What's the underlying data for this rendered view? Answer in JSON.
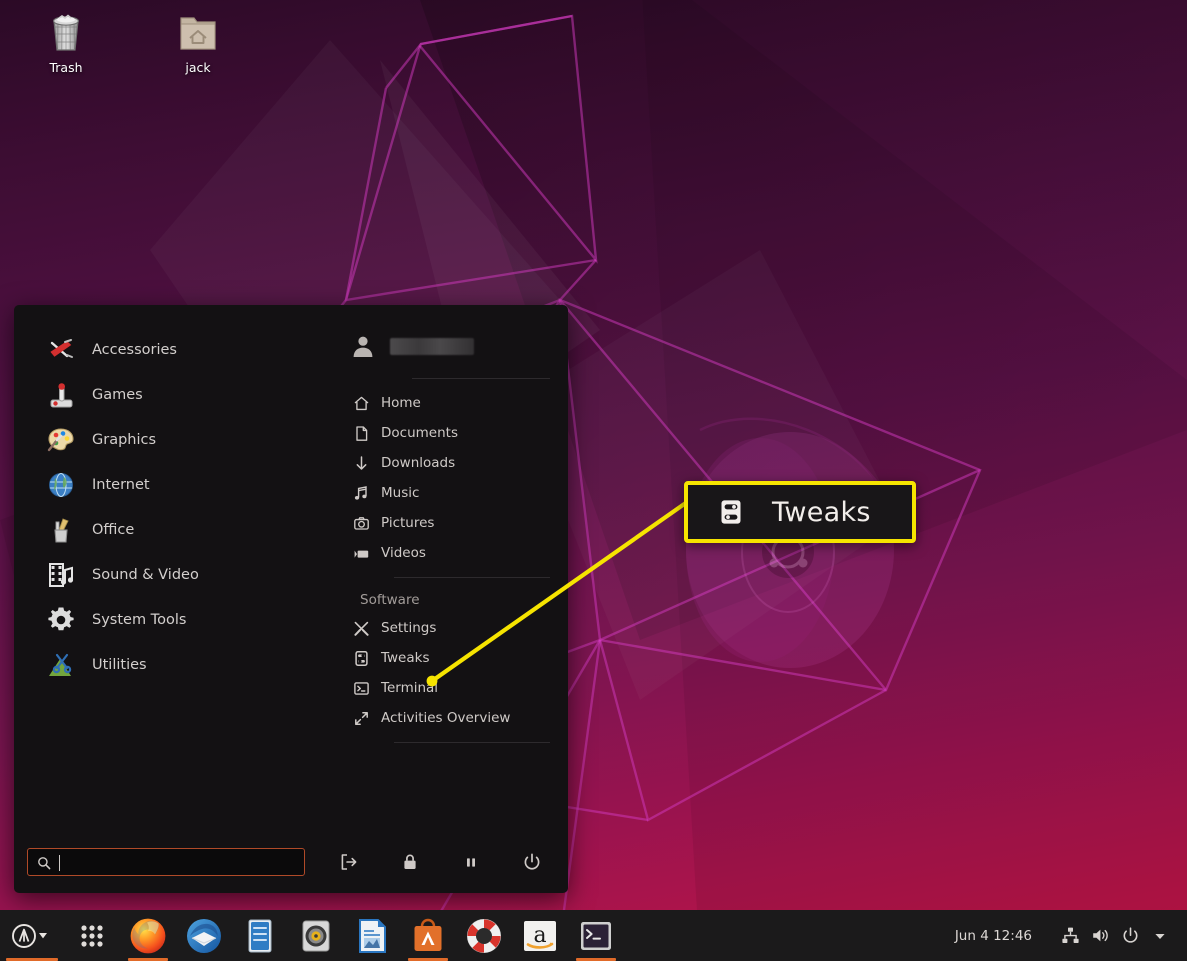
{
  "desktop": {
    "icons": [
      {
        "name": "trash",
        "label": "Trash",
        "icon": "trash-icon"
      },
      {
        "name": "home-folder",
        "label": "jack",
        "icon": "home-folder-icon"
      }
    ]
  },
  "menu": {
    "categories": [
      {
        "label": "Accessories",
        "icon": "swiss-army-knife-icon"
      },
      {
        "label": "Games",
        "icon": "joystick-icon"
      },
      {
        "label": "Graphics",
        "icon": "palette-icon"
      },
      {
        "label": "Internet",
        "icon": "globe-icon"
      },
      {
        "label": "Office",
        "icon": "pencil-cup-icon"
      },
      {
        "label": "Sound & Video",
        "icon": "film-music-icon"
      },
      {
        "label": "System Tools",
        "icon": "gear-icon"
      },
      {
        "label": "Utilities",
        "icon": "scissors-icon"
      }
    ],
    "user": {
      "name_redacted": true,
      "avatar_icon": "user-avatar-icon"
    },
    "places": [
      {
        "label": "Home",
        "icon": "home-icon"
      },
      {
        "label": "Documents",
        "icon": "document-icon"
      },
      {
        "label": "Downloads",
        "icon": "download-arrow-icon"
      },
      {
        "label": "Music",
        "icon": "music-note-icon"
      },
      {
        "label": "Pictures",
        "icon": "camera-icon"
      },
      {
        "label": "Videos",
        "icon": "video-icon"
      }
    ],
    "software_section_title": "Software",
    "software": [
      {
        "label": "Settings",
        "icon": "settings-tools-icon"
      },
      {
        "label": "Tweaks",
        "icon": "tweaks-icon"
      },
      {
        "label": "Terminal",
        "icon": "terminal-icon"
      },
      {
        "label": "Activities Overview",
        "icon": "expand-arrows-icon"
      }
    ],
    "search": {
      "value": "",
      "placeholder": ""
    },
    "session_buttons": [
      {
        "name": "log-out",
        "icon": "logout-icon"
      },
      {
        "name": "lock",
        "icon": "lock-icon"
      },
      {
        "name": "suspend",
        "icon": "pause-icon"
      },
      {
        "name": "shut-down",
        "icon": "power-icon"
      }
    ]
  },
  "callout": {
    "label": "Tweaks",
    "icon": "tweaks-icon",
    "border_color": "#f6e400"
  },
  "taskbar": {
    "menu_button_icon": "applications-logo-icon",
    "show_apps_icon": "grid-nine-dots-icon",
    "apps": [
      {
        "name": "firefox",
        "icon": "firefox-icon",
        "active": true
      },
      {
        "name": "thunderbird",
        "icon": "thunderbird-icon",
        "active": false
      },
      {
        "name": "files",
        "icon": "file-manager-icon",
        "active": false
      },
      {
        "name": "rhythmbox",
        "icon": "rhythmbox-icon",
        "active": false
      },
      {
        "name": "libreoffice",
        "icon": "libreoffice-icon",
        "active": false
      },
      {
        "name": "ubuntu-software",
        "icon": "software-bag-icon",
        "active": true
      },
      {
        "name": "help",
        "icon": "lifebuoy-icon",
        "active": false
      },
      {
        "name": "amazon",
        "icon": "amazon-icon",
        "active": false
      },
      {
        "name": "terminal",
        "icon": "terminal-app-icon",
        "active": true
      }
    ],
    "clock": "Jun 4  12:46",
    "tray": [
      {
        "name": "network",
        "icon": "network-icon"
      },
      {
        "name": "volume",
        "icon": "volume-icon"
      },
      {
        "name": "power",
        "icon": "power-icon"
      },
      {
        "name": "more",
        "icon": "chevron-down-icon"
      }
    ]
  }
}
